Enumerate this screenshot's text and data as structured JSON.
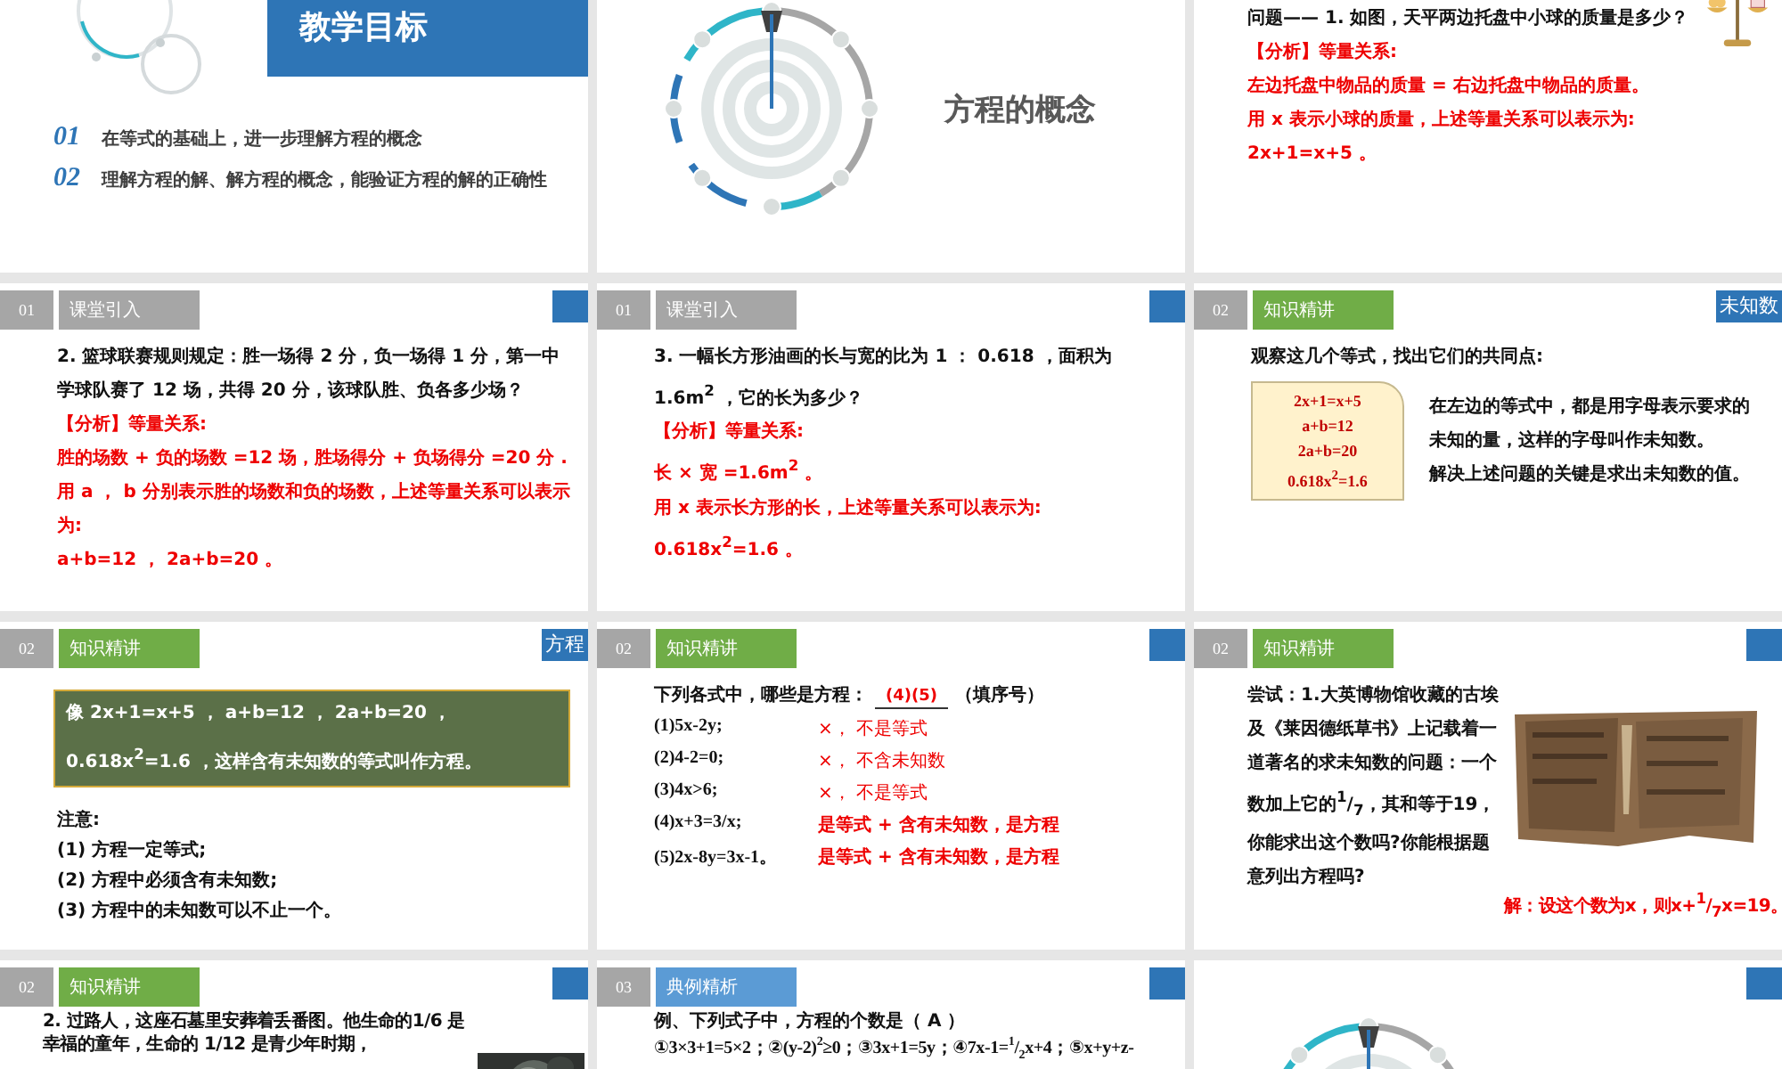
{
  "slides": [
    {
      "kind": "objectives",
      "title": "教学目标",
      "items": [
        {
          "number": "01",
          "text": "在等式的基础上，进一步理解方程的概念"
        },
        {
          "number": "02",
          "text": "理解方程的解、解方程的概念，能验证方程的解的正确性"
        }
      ]
    },
    {
      "kind": "section",
      "title": "方程的概念"
    },
    {
      "kind": "content",
      "figure": {
        "kind": "balance"
      },
      "blocks": [
        {
          "kind": "text",
          "text": "问题—— 1. 如图，天平两边托盘中小球的质量是多少？"
        },
        {
          "kind": "red",
          "text": "【分析】等量关系:"
        },
        {
          "kind": "red",
          "text": "左边托盘中物品的质量 = 右边托盘中物品的质量。"
        },
        {
          "kind": "red",
          "text": "用 x 表示小球的质量，上述等量关系可以表示为:"
        },
        {
          "kind": "red",
          "text": "2x+1=x+5 。"
        }
      ]
    },
    {
      "kind": "content",
      "header": {
        "number": "01",
        "label": "课堂引入",
        "color": "#a6a6a6"
      },
      "corner_tab": true,
      "blocks": [
        {
          "kind": "text",
          "text": "2. 篮球联赛规则规定：胜一场得 2 分，负一场得 1 分，第一中学球队赛了 12 场，共得 20 分，该球队胜、负各多少场？"
        },
        {
          "kind": "red",
          "text": "【分析】等量关系:"
        },
        {
          "kind": "red",
          "text": "胜的场数 + 负的场数 =12 场，胜场得分 + 负场得分 =20 分 ."
        },
        {
          "kind": "red",
          "text": "用 a ， b 分别表示胜的场数和负的场数，上述等量关系可以表示为:"
        },
        {
          "kind": "red",
          "text": "a+b=12 ， 2a+b=20 。"
        }
      ]
    },
    {
      "kind": "content",
      "header": {
        "number": "01",
        "label": "课堂引入",
        "color": "#a6a6a6"
      },
      "corner_tab": true,
      "blocks": [
        {
          "kind": "text",
          "text": "3. 一幅长方形油画的长与宽的比为 1 ： 0.618 ，面积为 1.6m$^{2}$ ，它的长为多少？"
        },
        {
          "kind": "red",
          "text": "【分析】等量关系:"
        },
        {
          "kind": "red",
          "text": "长 × 宽 =1.6m$^{2}$ 。"
        },
        {
          "kind": "red",
          "text": "用 x 表示长方形的长，上述等量关系可以表示为:"
        },
        {
          "kind": "red",
          "text": "0.618x$^{2}$=1.6 。"
        }
      ]
    },
    {
      "kind": "content",
      "header": {
        "number": "02",
        "label": "知识精讲",
        "color": "#70ad47"
      },
      "corner_tab": true,
      "corner_label": "未知数",
      "blocks": [
        {
          "kind": "text",
          "text": "观察这几个等式，找出它们的共同点:"
        },
        {
          "kind": "eq_box",
          "items": [
            "2x+1=x+5",
            "a+b=12",
            "2a+b=20",
            "0.618x$^{2}$=1.6"
          ],
          "side": [
            "在左边的等式中，都是**用字母表示要求的未知的量**，这样的字母叫作**未知数**。",
            "解决上述问题的关键是求出未知数的值。"
          ]
        }
      ]
    },
    {
      "kind": "content",
      "header": {
        "number": "02",
        "label": "知识精讲",
        "color": "#70ad47"
      },
      "corner_tab": true,
      "corner_label": "方程",
      "blocks": [
        {
          "kind": "def_box",
          "text": "像 2x+1=x+5 ， a+b=12 ， 2a+b=20 ， 0.618x$^{2}$=1.6 ，这样含有**未知数**的**等式**叫作方程。"
        },
        {
          "kind": "note",
          "lines": [
            "注意:",
            "(1) 方程一定等式;",
            "(2) 方程中必须含有未知数;",
            "(3) 方程中的未知数可以不止一个。"
          ]
        }
      ]
    },
    {
      "kind": "content",
      "header": {
        "number": "02",
        "label": "知识精讲",
        "color": "#70ad47"
      },
      "corner_tab": true,
      "blocks": [
        {
          "kind": "fill",
          "prompt": "下列各式中，哪些是方程：",
          "answer": "(4)(5)",
          "suffix": "（填序号）"
        },
        {
          "kind": "choices",
          "rows": [
            {
              "expr": "(1)5x-2y;",
              "verdict": "×， 不是等式",
              "correct": false
            },
            {
              "expr": "(2)4-2=0;",
              "verdict": "×， 不含未知数",
              "correct": false
            },
            {
              "expr": "(3)4x>6;",
              "verdict": "×， 不是等式",
              "correct": false
            },
            {
              "expr": "(4)x+3=3/x;",
              "verdict": "是等式 + 含有未知数，是方程",
              "correct": true
            },
            {
              "expr": "(5)2x-8y=3x-1。",
              "verdict": "是等式 + 含有未知数，是方程",
              "correct": true
            }
          ]
        }
      ]
    },
    {
      "kind": "content",
      "header": {
        "number": "02",
        "label": "知识精讲",
        "color": "#70ad47"
      },
      "corner_tab": true,
      "figure": {
        "kind": "papyrus",
        "caption": "解：设这个数为x，则x+$^{1}$/$_{7}$x=19。"
      },
      "blocks": [
        {
          "kind": "text",
          "text": "尝试：1.大英博物馆收藏的古埃及《莱因德纸草书》上记载着一道著名的求未知数的问题：一个数加上它的$^{1}$/$_{7}$，其和等于19，你能求出这个数吗?你能根据题意列出方程吗?"
        }
      ]
    },
    {
      "kind": "content",
      "header": {
        "number": "02",
        "label": "知识精讲",
        "color": "#70ad47"
      },
      "corner_tab": true,
      "figure": {
        "kind": "statue"
      },
      "blocks": [
        {
          "kind": "story",
          "text": "2. 过路人，这座石墓里安葬着丢番图。他**生命的1/6** 是幸福的童年，**生命的 1/12** 是青少年时期，"
        }
      ]
    },
    {
      "kind": "content",
      "header": {
        "number": "03",
        "label": "典例精析",
        "color": "#5b9bd5"
      },
      "corner_tab": true,
      "blocks": [
        {
          "kind": "text",
          "text": "例、下列式子中，方程的个数是（ **A** ）"
        },
        {
          "kind": "formula",
          "text": "①3×3+1=5×2；②(y-2)$^{2}$≥0；③3x+1=5y；④7x-1=$^{1}$/$_{2}$x+4；⑤x+y+z-"
        }
      ]
    },
    {
      "kind": "section",
      "corner_tab": true
    }
  ]
}
